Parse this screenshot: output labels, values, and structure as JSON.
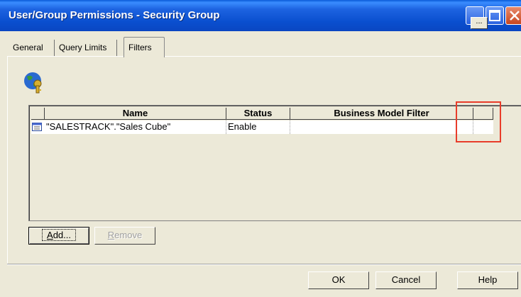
{
  "window": {
    "title": "User/Group Permissions - Security Group",
    "controls": {
      "minimize_icon": "minimize-icon",
      "maximize_icon": "maximize-icon",
      "close_icon": "close-icon"
    }
  },
  "tabs": [
    {
      "label": "General"
    },
    {
      "label": "Query Limits"
    },
    {
      "label": "Filters"
    }
  ],
  "active_tab": "Filters",
  "icon": "globe-key-icon",
  "grid": {
    "columns": [
      {
        "label": "Name"
      },
      {
        "label": "Status"
      },
      {
        "label": "Business Model Filter"
      },
      {
        "label": ""
      }
    ],
    "rows": [
      {
        "icon": "table-row-icon",
        "name": "\"SALESTRACK\".\"Sales Cube\"",
        "status": "Enable",
        "filter": "",
        "edit_label": "..."
      }
    ]
  },
  "buttons": {
    "add_prefix": "A",
    "add_rest": "dd...",
    "remove_prefix": "R",
    "remove_rest": "emove",
    "ok": "OK",
    "cancel": "Cancel",
    "help": "Help"
  },
  "colors": {
    "titlebar": "#0a4fcf",
    "highlight": "#e83c2a",
    "face": "#ece9d8"
  }
}
